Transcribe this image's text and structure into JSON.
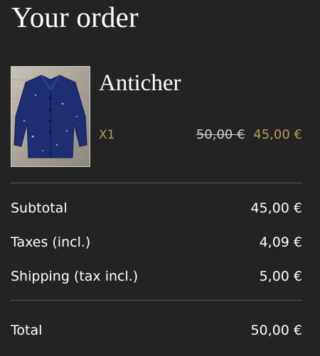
{
  "header": {
    "title": "Your order"
  },
  "item": {
    "name": "Anticher",
    "quantity": "X1",
    "original_price": "50,00 €",
    "sale_price": "45,00 €",
    "image_icon": "blue-jacket-product-photo"
  },
  "summary": {
    "subtotal_label": "Subtotal",
    "subtotal_value": "45,00 €",
    "taxes_label": "Taxes (incl.)",
    "taxes_value": "4,09 €",
    "shipping_label": "Shipping (tax incl.)",
    "shipping_value": "5,00 €"
  },
  "total": {
    "label": "Total",
    "value": "50,00 €"
  },
  "colors": {
    "background": "#232323",
    "accent": "#b89c5a",
    "text": "#ffffff",
    "divider": "#5a5a5a"
  }
}
